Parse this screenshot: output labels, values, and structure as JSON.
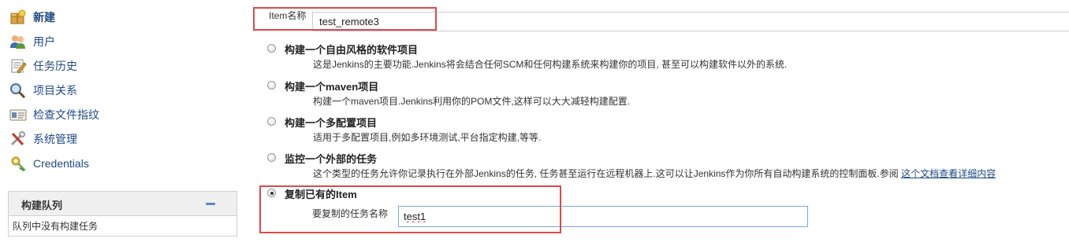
{
  "sidebar": {
    "items": [
      {
        "label": "新建",
        "icon": "new-item-icon"
      },
      {
        "label": "用户",
        "icon": "users-icon"
      },
      {
        "label": "任务历史",
        "icon": "history-icon"
      },
      {
        "label": "项目关系",
        "icon": "search-icon"
      },
      {
        "label": "检查文件指纹",
        "icon": "fingerprint-icon"
      },
      {
        "label": "系统管理",
        "icon": "tools-icon"
      },
      {
        "label": "Credentials",
        "icon": "credentials-icon"
      }
    ],
    "queue": {
      "title": "构建队列",
      "empty_text": "队列中没有构建任务"
    }
  },
  "form": {
    "name_label": "Item名称",
    "name_value": "test_remote3",
    "options": [
      {
        "title": "构建一个自由风格的软件项目",
        "desc": "这是Jenkins的主要功能.Jenkins将会结合任何SCM和任何构建系统来构建你的项目, 甚至可以构建软件以外的系统.",
        "checked": false
      },
      {
        "title": "构建一个maven项目",
        "desc": "构建一个maven项目.Jenkins利用你的POM文件,这样可以大大减轻构建配置.",
        "checked": false
      },
      {
        "title": "构建一个多配置项目",
        "desc": "适用于多配置项目,例如多环境测试,平台指定构建,等等.",
        "checked": false
      },
      {
        "title": "监控一个外部的任务",
        "desc": "这个类型的任务允许你记录执行在外部Jenkins的任务, 任务甚至运行在远程机器上.这可以让Jenkins作为你所有自动构建系统的控制面板.参阅",
        "link": "这个文档查看详细内容",
        "checked": false
      },
      {
        "title": "复制已有的Item",
        "checked": true
      }
    ],
    "copy_label": "要复制的任务名称",
    "copy_value": "test1"
  },
  "colors": {
    "highlight_border": "#e04848",
    "link": "#204a87"
  }
}
